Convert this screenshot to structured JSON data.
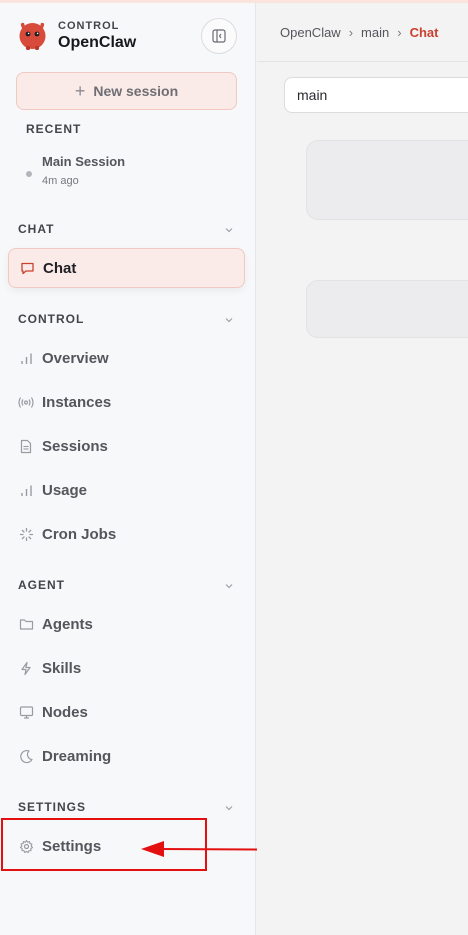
{
  "brand": {
    "sub": "CONTROL",
    "title": "OpenClaw"
  },
  "sidebar": {
    "new_session": "New session",
    "recent_label": "RECENT",
    "recent": [
      {
        "title": "Main Session",
        "time": "4m ago"
      }
    ],
    "sections": [
      {
        "label": "CHAT",
        "items": [
          {
            "label": "Chat",
            "icon": "chat-bubble-icon",
            "active": true
          }
        ]
      },
      {
        "label": "CONTROL",
        "items": [
          {
            "label": "Overview",
            "icon": "bar-chart-icon"
          },
          {
            "label": "Instances",
            "icon": "broadcast-icon"
          },
          {
            "label": "Sessions",
            "icon": "document-icon"
          },
          {
            "label": "Usage",
            "icon": "bar-chart-icon"
          },
          {
            "label": "Cron Jobs",
            "icon": "loader-icon"
          }
        ]
      },
      {
        "label": "AGENT",
        "items": [
          {
            "label": "Agents",
            "icon": "folder-icon"
          },
          {
            "label": "Skills",
            "icon": "lightning-icon"
          },
          {
            "label": "Nodes",
            "icon": "monitor-icon"
          },
          {
            "label": "Dreaming",
            "icon": "moon-icon"
          }
        ]
      },
      {
        "label": "SETTINGS",
        "items": [
          {
            "label": "Settings",
            "icon": "gear-icon"
          }
        ]
      }
    ]
  },
  "main": {
    "breadcrumb": [
      "OpenClaw",
      "main",
      "Chat"
    ],
    "session_select": "main"
  },
  "colors": {
    "accent": "#c9412f",
    "annotation": "#e41010"
  }
}
